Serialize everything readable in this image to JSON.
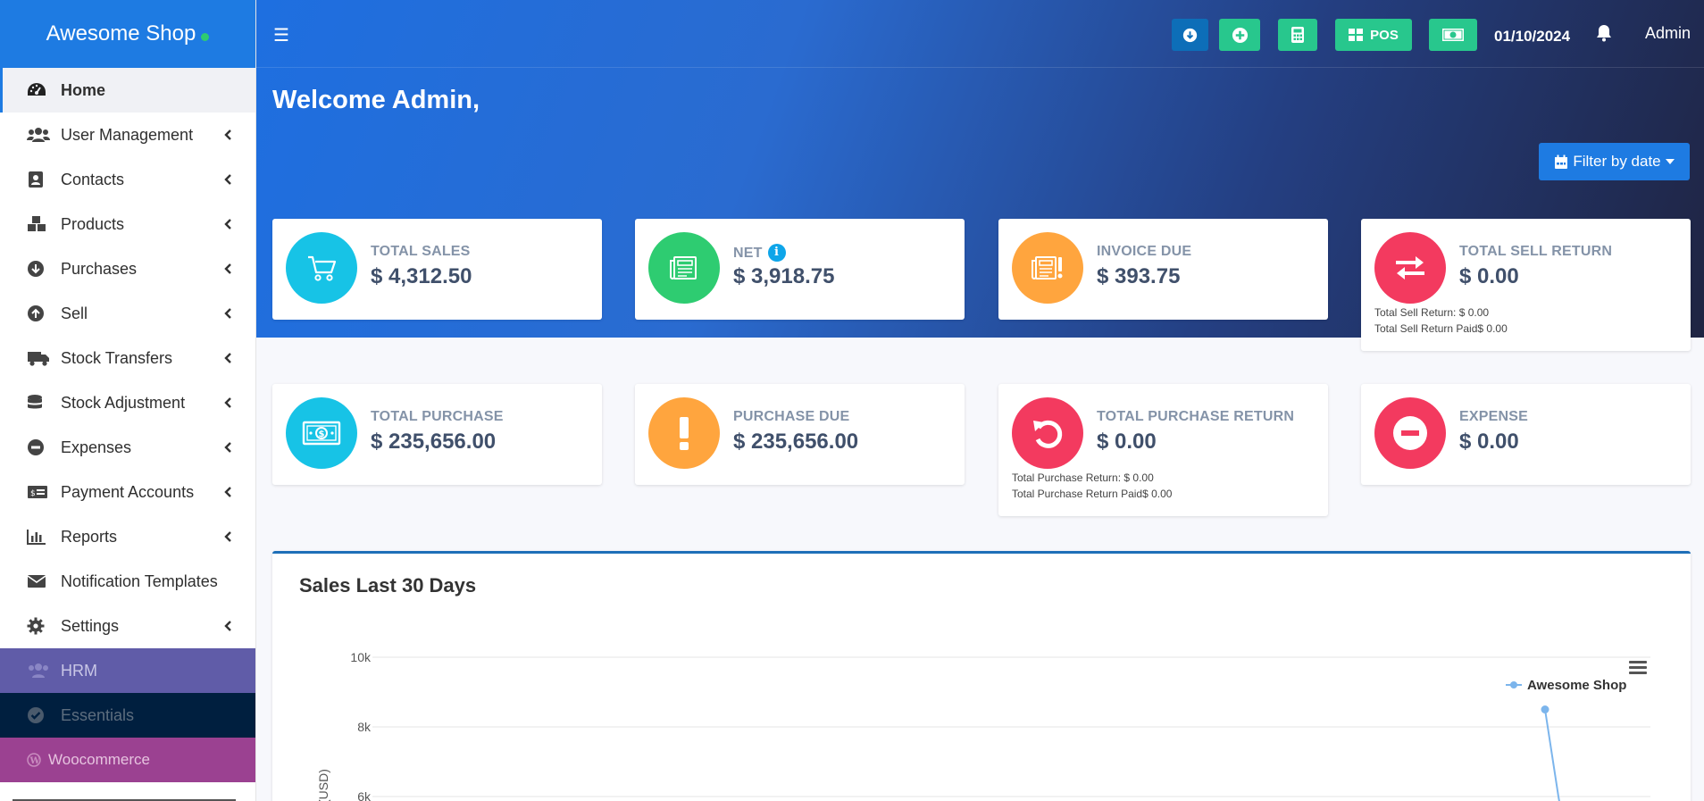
{
  "brand": {
    "name": "Awesome Shop"
  },
  "sidebar": {
    "items": [
      {
        "label": "Home",
        "icon": "dashboard-icon"
      },
      {
        "label": "User Management",
        "icon": "users-icon"
      },
      {
        "label": "Contacts",
        "icon": "address-book-icon"
      },
      {
        "label": "Products",
        "icon": "cubes-icon"
      },
      {
        "label": "Purchases",
        "icon": "arrow-circle-down-icon"
      },
      {
        "label": "Sell",
        "icon": "arrow-circle-up-icon"
      },
      {
        "label": "Stock Transfers",
        "icon": "truck-icon"
      },
      {
        "label": "Stock Adjustment",
        "icon": "database-icon"
      },
      {
        "label": "Expenses",
        "icon": "minus-circle-icon"
      },
      {
        "label": "Payment Accounts",
        "icon": "money-check-icon"
      },
      {
        "label": "Reports",
        "icon": "bar-chart-icon"
      },
      {
        "label": "Notification Templates",
        "icon": "envelope-icon"
      },
      {
        "label": "Settings",
        "icon": "gear-icon"
      },
      {
        "label": "HRM",
        "icon": "users-icon"
      },
      {
        "label": "Essentials",
        "icon": "check-circle-icon"
      },
      {
        "label": "Woocommerce",
        "icon": "wordpress-icon"
      }
    ]
  },
  "header": {
    "pos_label": "POS",
    "date": "01/10/2024",
    "user": "Admin"
  },
  "welcome": "Welcome Admin,",
  "filter_label": "Filter by date",
  "stats": {
    "total_sales": {
      "title": "TOTAL SALES",
      "value": "$ 4,312.50"
    },
    "net": {
      "title": "NET",
      "value": "$ 3,918.75"
    },
    "invoice_due": {
      "title": "INVOICE DUE",
      "value": "$ 393.75"
    },
    "total_sell_return": {
      "title": "TOTAL SELL RETURN",
      "value": "$ 0.00",
      "line1": "Total Sell Return: $ 0.00",
      "line2": "Total Sell Return Paid$ 0.00"
    },
    "total_purchase": {
      "title": "TOTAL PURCHASE",
      "value": "$ 235,656.00"
    },
    "purchase_due": {
      "title": "PURCHASE DUE",
      "value": "$ 235,656.00"
    },
    "total_purchase_return": {
      "title": "TOTAL PURCHASE RETURN",
      "value": "$ 0.00",
      "line1": "Total Purchase Return: $ 0.00",
      "line2": "Total Purchase Return Paid$ 0.00"
    },
    "expense": {
      "title": "EXPENSE",
      "value": "$ 0.00"
    }
  },
  "colors": {
    "brand_blue": "#1e7be2",
    "cyan": "#17c3e6",
    "green": "#2ecc71",
    "orange": "#ffa53e",
    "red": "#f33a5f",
    "series": "#7cb5ec"
  },
  "chart_title": "Sales Last 30 Days",
  "chart_data": {
    "type": "line",
    "title": "Sales Last 30 Days",
    "ylabel": "(USD)",
    "yticks": [
      "10k",
      "8k",
      "6k"
    ],
    "ylim": [
      6000,
      10000
    ],
    "series": [
      {
        "name": "Awesome Shop",
        "points": [
          {
            "y": 8500
          },
          {
            "y": 6000
          }
        ]
      }
    ]
  }
}
